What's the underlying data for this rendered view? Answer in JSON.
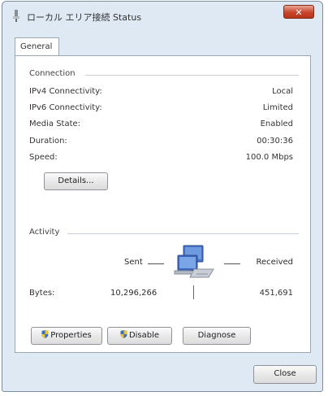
{
  "window": {
    "title": "ローカル エリア接続 Status",
    "close_glyph": "✕"
  },
  "tabs": [
    {
      "label": "General"
    }
  ],
  "connection": {
    "title": "Connection",
    "rows": [
      {
        "label": "IPv4 Connectivity:",
        "value": "Local"
      },
      {
        "label": "IPv6 Connectivity:",
        "value": "Limited"
      },
      {
        "label": "Media State:",
        "value": "Enabled"
      },
      {
        "label": "Duration:",
        "value": "00:30:36"
      },
      {
        "label": "Speed:",
        "value": "100.0 Mbps"
      }
    ],
    "details_button": "Details..."
  },
  "activity": {
    "title": "Activity",
    "sent_label": "Sent",
    "received_label": "Received",
    "bytes_label": "Bytes:",
    "bytes_sent": "10,296,266",
    "bytes_received": "451,691",
    "network_icon": "network-computers-icon"
  },
  "buttons": {
    "properties": "Properties",
    "disable": "Disable",
    "diagnose": "Diagnose",
    "close": "Close"
  },
  "colors": {
    "window_frame": "#dfe9f3",
    "close_red": "#c8452c",
    "shield_blue": "#3b6fb6",
    "shield_yellow": "#e8c23a"
  }
}
